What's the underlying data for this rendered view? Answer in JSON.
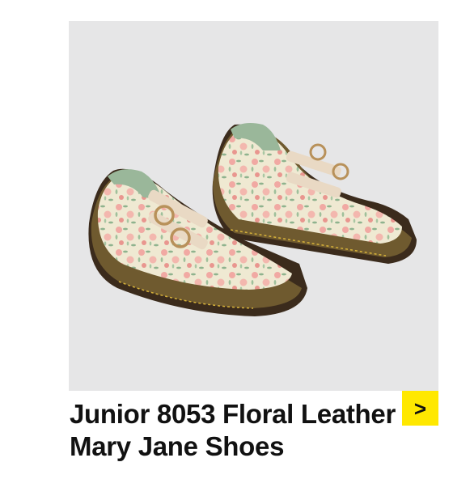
{
  "product": {
    "title": "Junior 8053 Floral Leather Mary Jane Shoes",
    "image_alt": "Junior 8053 Floral Leather Mary Jane Shoes",
    "image_background": "#e6e6e7"
  },
  "action": {
    "arrow_glyph": ">",
    "button_color": "#ffe800",
    "icon": "chevron-right-icon"
  }
}
